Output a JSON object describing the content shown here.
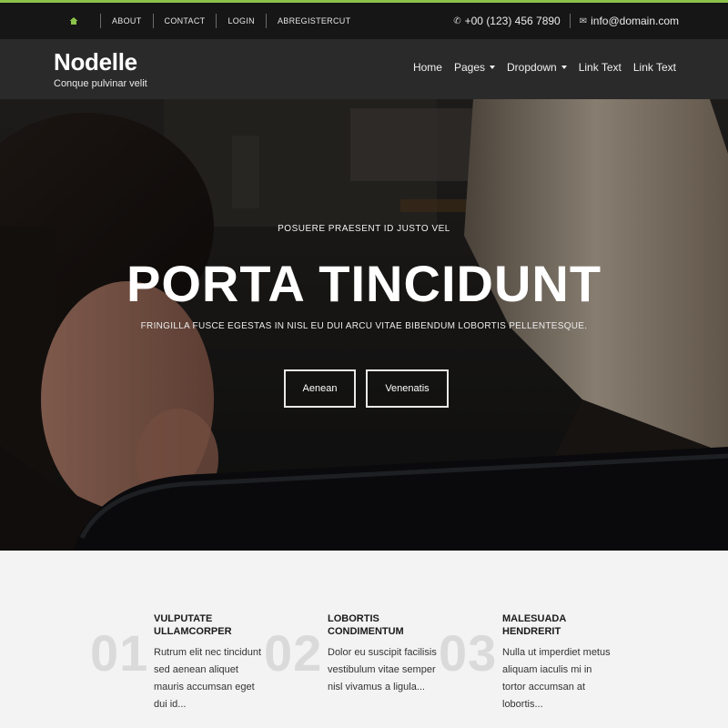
{
  "colors": {
    "accent": "#8bc34a",
    "topbar_bg": "#161616",
    "navbar_bg": "#2a2a2a",
    "features_bg": "#f3f3f3"
  },
  "topbar": {
    "home_icon": "home-icon",
    "links": [
      "About",
      "Contact",
      "Login",
      "Abregistercut"
    ],
    "phone_icon": "phone-icon",
    "phone": "+00 (123) 456 7890",
    "email_icon": "envelope-icon",
    "email": "info@domain.com"
  },
  "brand": {
    "name": "Nodelle",
    "tagline": "Conque pulvinar velit"
  },
  "nav": {
    "items": [
      {
        "label": "Home"
      },
      {
        "label": "Pages"
      },
      {
        "label": "Dropdown"
      },
      {
        "label": "Link Text"
      },
      {
        "label": "Link Text"
      }
    ]
  },
  "hero": {
    "kicker": "Posuere praesent id justo vel",
    "headline": "PORTA TINCIDUNT",
    "subtitle": "Fringilla fusce egestas in nisl eu dui arcu vitae bibendum lobortis pellentesque.",
    "buttons": [
      "Aenean",
      "Venenatis"
    ]
  },
  "features": [
    {
      "number": "01",
      "title": "Vulputate ullamcorper",
      "text": "Rutrum elit nec tincidunt sed aenean aliquet mauris accumsan eget dui id..."
    },
    {
      "number": "02",
      "title": "Lobortis condimentum",
      "text": "Dolor eu suscipit facilisis vestibulum vitae semper nisl vivamus a ligula..."
    },
    {
      "number": "03",
      "title": "Malesuada hendrerit",
      "text": "Nulla ut imperdiet metus aliquam iaculis mi in tortor accumsan at lobortis..."
    }
  ]
}
